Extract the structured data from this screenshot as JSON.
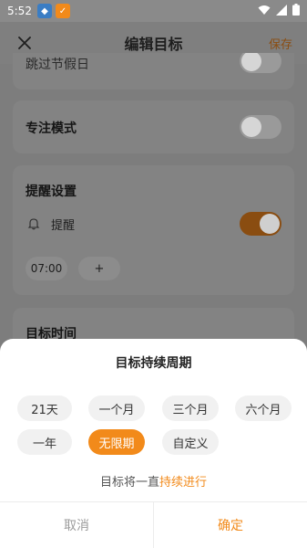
{
  "status_bar": {
    "time": "5:52"
  },
  "header": {
    "title": "编辑目标",
    "save_label": "保存"
  },
  "background": {
    "partial_item_label": "跳过节假日",
    "focus_mode_label": "专注模式",
    "reminder_section_title": "提醒设置",
    "reminder_label": "提醒",
    "reminder_time": "07:00",
    "add_time_label": "+",
    "target_time_title": "目标时间"
  },
  "sheet": {
    "title": "目标持续周期",
    "options": [
      "21天",
      "一个月",
      "三个月",
      "六个月",
      "一年",
      "无限期",
      "自定义"
    ],
    "selected": "无限期",
    "hint_prefix": "目标将一直",
    "hint_accent": "持续进行",
    "cancel_label": "取消",
    "confirm_label": "确定"
  },
  "colors": {
    "accent": "#f28a1a"
  }
}
